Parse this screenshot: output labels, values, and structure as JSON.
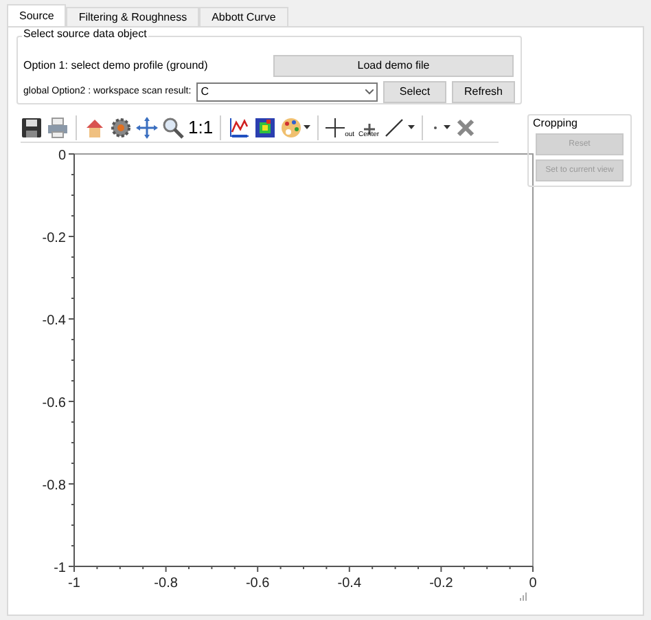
{
  "tabs": [
    {
      "label": "Source",
      "selected": true
    },
    {
      "label": "Filtering & Roughness",
      "selected": false
    },
    {
      "label": "Abbott Curve",
      "selected": false
    }
  ],
  "source_group": {
    "title": "Select source data object",
    "option1_label": "Option 1: select demo profile (ground)",
    "load_button": "Load demo file",
    "option2_label": "global Option2 : workspace scan result:",
    "scan_select": {
      "value": "C"
    },
    "select_button": "Select",
    "refresh_button": "Refresh"
  },
  "toolbar": {
    "one_to_one": "1:1",
    "zoom_out_label": "out",
    "center_label": "Center"
  },
  "cropping": {
    "title": "Cropping",
    "buttons": [
      {
        "label": "Reset",
        "disabled": true
      },
      {
        "label": "Set to current view",
        "disabled": true
      }
    ]
  },
  "plot": {
    "chart_data": {
      "type": "line",
      "xlim": [
        -1,
        0
      ],
      "ylim": [
        -1,
        0
      ],
      "xticks": [
        {
          "value": -1,
          "label": "-1"
        },
        {
          "value": -0.8,
          "label": "-0.8"
        },
        {
          "value": -0.6,
          "label": "-0.6"
        },
        {
          "value": -0.4,
          "label": "-0.4"
        },
        {
          "value": -0.2,
          "label": "-0.2"
        },
        {
          "value": 0,
          "label": "0"
        }
      ],
      "yticks": [
        {
          "value": 0,
          "label": "0"
        },
        {
          "value": -0.2,
          "label": "-0.2"
        },
        {
          "value": -0.4,
          "label": "-0.4"
        },
        {
          "value": -0.6,
          "label": "-0.6"
        },
        {
          "value": -0.8,
          "label": "-0.8"
        },
        {
          "value": -1,
          "label": "-1"
        }
      ]
    }
  }
}
